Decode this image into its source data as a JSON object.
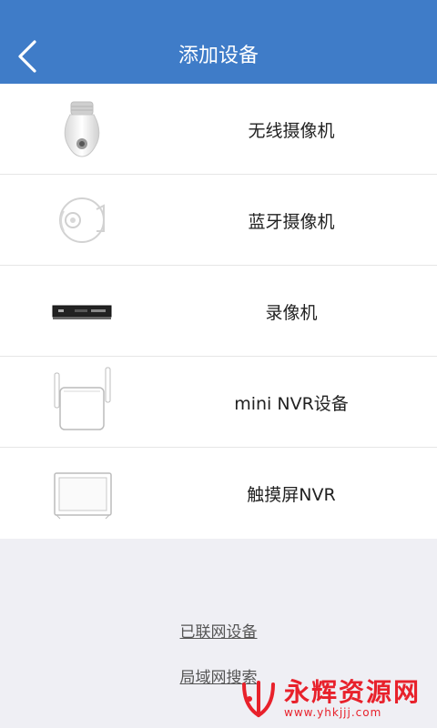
{
  "header": {
    "title": "添加设备",
    "back_icon": "chevron-left-icon",
    "bg_color": "#3f7cc8"
  },
  "devices": [
    {
      "label": "无线摄像机",
      "icon": "bulb-camera-icon"
    },
    {
      "label": "蓝牙摄像机",
      "icon": "dome-camera-icon"
    },
    {
      "label": "录像机",
      "icon": "recorder-icon"
    },
    {
      "label": "mini NVR设备",
      "icon": "mini-nvr-icon"
    },
    {
      "label": "触摸屏NVR",
      "icon": "touchscreen-nvr-icon"
    }
  ],
  "links": {
    "connected_devices": "已联网设备",
    "lan_search": "局域网搜索"
  },
  "watermark": {
    "text": "永辉资源网",
    "url": "www.yhkjjj.com",
    "color": "#e8212b"
  }
}
